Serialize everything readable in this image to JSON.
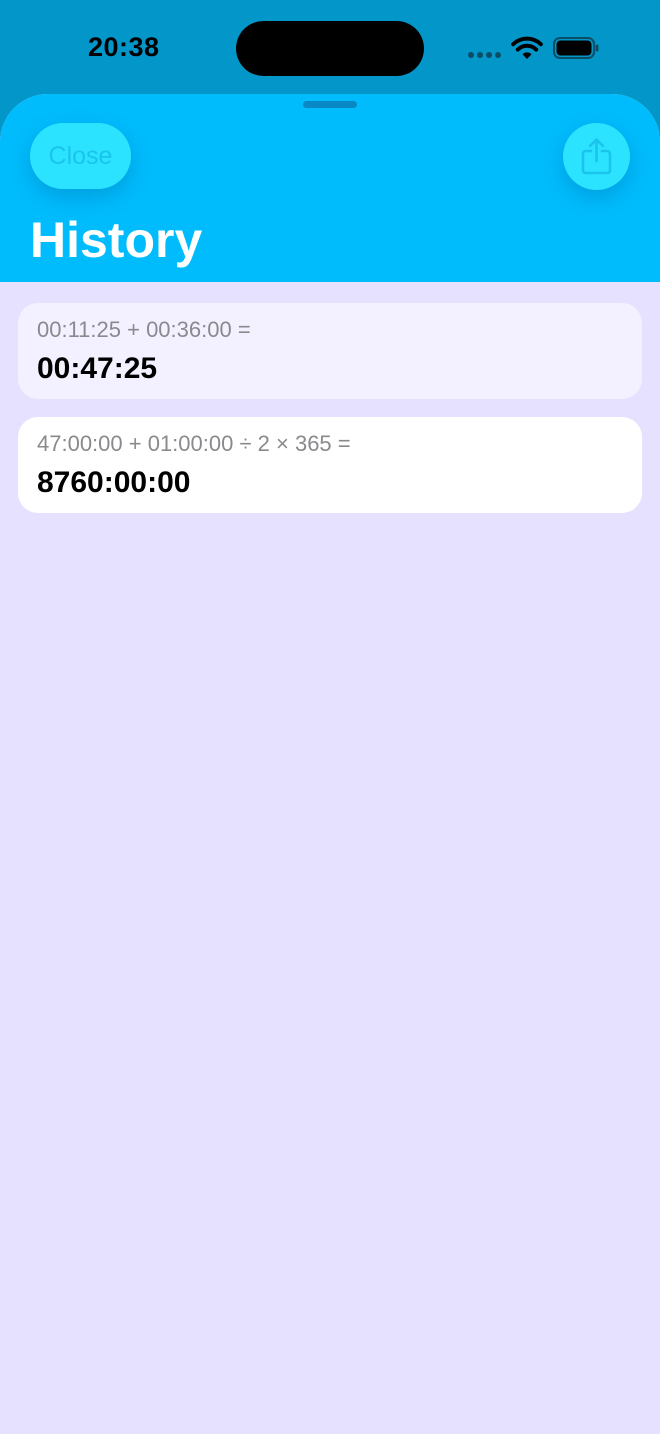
{
  "status_bar": {
    "time": "20:38"
  },
  "header": {
    "title": "History",
    "close_label": "Close",
    "share_icon": "share-icon"
  },
  "history": [
    {
      "expression": "00:11:25 + 00:36:00 =",
      "result": "00:47:25"
    },
    {
      "expression": "47:00:00 + 01:00:00 ÷ 2 × 365 =",
      "result": "8760:00:00"
    }
  ],
  "colors": {
    "status_bar_bg": "#0396c9",
    "header_bg": "#00bcfd",
    "button_bg": "#2be3ff",
    "sheet_bg": "#e6e1ff",
    "card_bg": "#ffffff",
    "card_selected_bg": "#f3f1ff"
  }
}
